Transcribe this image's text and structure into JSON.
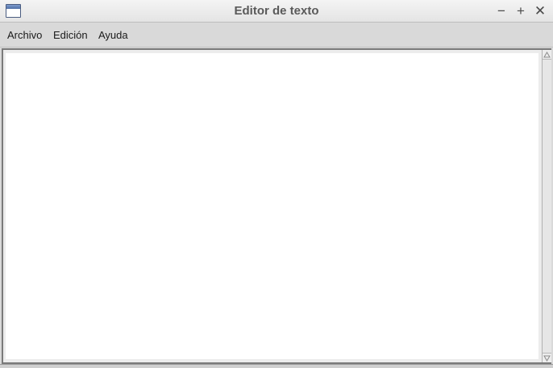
{
  "window": {
    "title": "Editor de texto",
    "icon": "window-app-icon",
    "controls": {
      "minimize": "−",
      "maximize": "+",
      "close": "✕"
    }
  },
  "menubar": {
    "items": [
      {
        "label": "Archivo"
      },
      {
        "label": "Edición"
      },
      {
        "label": "Ayuda"
      }
    ]
  },
  "editor": {
    "content": ""
  },
  "colors": {
    "titlebar": "#ececec",
    "menubar": "#d9d9d9",
    "editor_background": "#ffffff"
  }
}
